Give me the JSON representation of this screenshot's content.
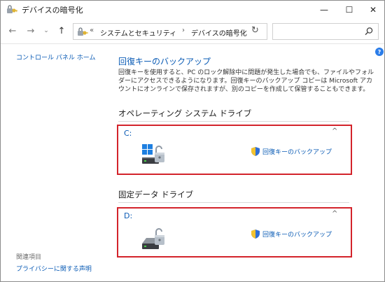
{
  "window": {
    "title": "デバイスの暗号化",
    "controls": {
      "minimize": "—",
      "maximize": "☐",
      "close": "✕"
    }
  },
  "nav": {
    "back": "←",
    "forward": "→",
    "recent": "⌄",
    "up": "↑"
  },
  "address": {
    "overflow": "«",
    "crumbs": [
      "システムとセキュリティ",
      "デバイスの暗号化"
    ],
    "separator": "›",
    "dropdown": "⌄",
    "refresh": "↻"
  },
  "search": {
    "placeholder": ""
  },
  "sidebar": {
    "home": "コントロール パネル ホーム",
    "related_heading": "関連項目",
    "privacy_link": "プライバシーに関する声明"
  },
  "main": {
    "backup_link": "回復キーのバックアップ",
    "description": "回復キーを使用すると、PC のロック解除中に問題が発生した場合でも、ファイルやフォルダーにアクセスできるようになります。回復キーのバックアップ コピーは Microsoft アカウントにオンラインで保存されますが、別のコピーを作成して保管することもできます。",
    "os_section": "オペレーティング システム ドライブ",
    "fixed_section": "固定データ ドライブ",
    "drives": [
      {
        "letter": "C:",
        "action": "回復キーのバックアップ",
        "collapse": "^"
      },
      {
        "letter": "D:",
        "action": "回復キーのバックアップ",
        "collapse": "^"
      }
    ]
  },
  "colors": {
    "link": "#0a5bb5",
    "highlight": "#d3232b",
    "help": "#2b7de9"
  }
}
